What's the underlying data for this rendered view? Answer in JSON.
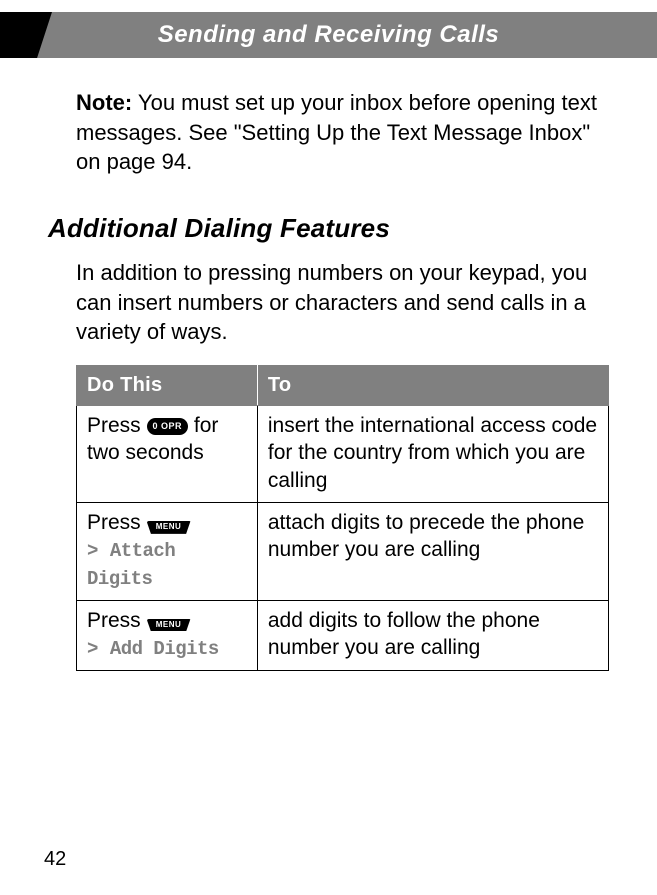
{
  "header": {
    "title": "Sending and Receiving Calls"
  },
  "note": {
    "label": "Note:",
    "text": " You must set up your inbox before opening text messages. See \"Setting Up the Text Message Inbox\" on page 94."
  },
  "section": {
    "heading": "Additional Dialing Features",
    "intro": "In addition to pressing numbers on your keypad, you can insert numbers or characters and send calls in a variety of ways."
  },
  "table": {
    "headers": {
      "col1": "Do This",
      "col2": "To"
    },
    "rows": [
      {
        "press": "Press ",
        "key_label": "0 OPR",
        "after_key": " for two seconds",
        "menu_path": "",
        "to": "insert the international access code for the country from which you are calling"
      },
      {
        "press": "Press ",
        "key_label": "MENU",
        "after_key": "",
        "gt": "> ",
        "menu_path": "Attach Digits",
        "to": "attach digits to precede the phone number you are calling"
      },
      {
        "press": "Press ",
        "key_label": "MENU",
        "after_key": "",
        "gt": "> ",
        "menu_path": "Add Digits",
        "to": "add digits to follow the phone number you are calling"
      }
    ]
  },
  "page_number": "42"
}
